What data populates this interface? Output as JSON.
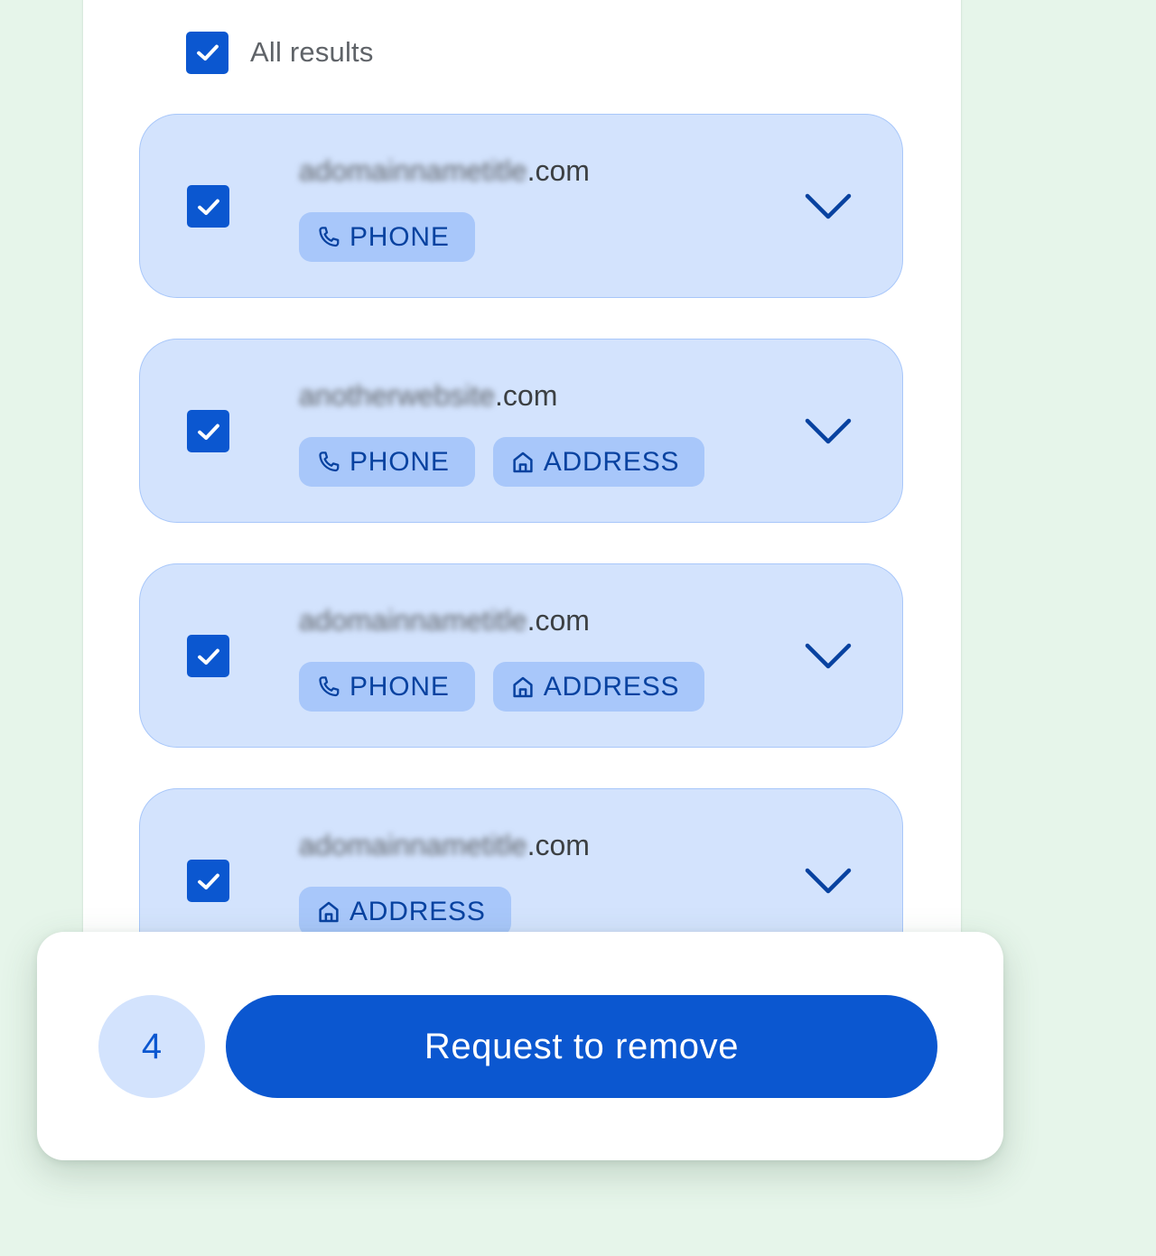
{
  "colors": {
    "page_background": "#e6f5ea",
    "accent": "#0b57d0",
    "card_background": "#d3e3fd",
    "tag_background": "#a8c7fa",
    "tag_text": "#0842a0"
  },
  "select_all": {
    "label": "All results",
    "checked": true
  },
  "results": [
    {
      "domain_name": "adomainnametitle",
      "domain_suffix": ".com",
      "checked": true,
      "tags": [
        {
          "label": "PHONE",
          "icon": "phone-icon"
        }
      ]
    },
    {
      "domain_name": "anotherwebsite",
      "domain_suffix": ".com",
      "checked": true,
      "tags": [
        {
          "label": "PHONE",
          "icon": "phone-icon"
        },
        {
          "label": "ADDRESS",
          "icon": "home-icon"
        }
      ]
    },
    {
      "domain_name": "adomainnametitle",
      "domain_suffix": ".com",
      "checked": true,
      "tags": [
        {
          "label": "PHONE",
          "icon": "phone-icon"
        },
        {
          "label": "ADDRESS",
          "icon": "home-icon"
        }
      ]
    },
    {
      "domain_name": "adomainnametitle",
      "domain_suffix": ".com",
      "checked": true,
      "tags": [
        {
          "label": "ADDRESS",
          "icon": "home-icon"
        }
      ]
    }
  ],
  "action_bar": {
    "selected_count": "4",
    "button_label": "Request to remove"
  }
}
